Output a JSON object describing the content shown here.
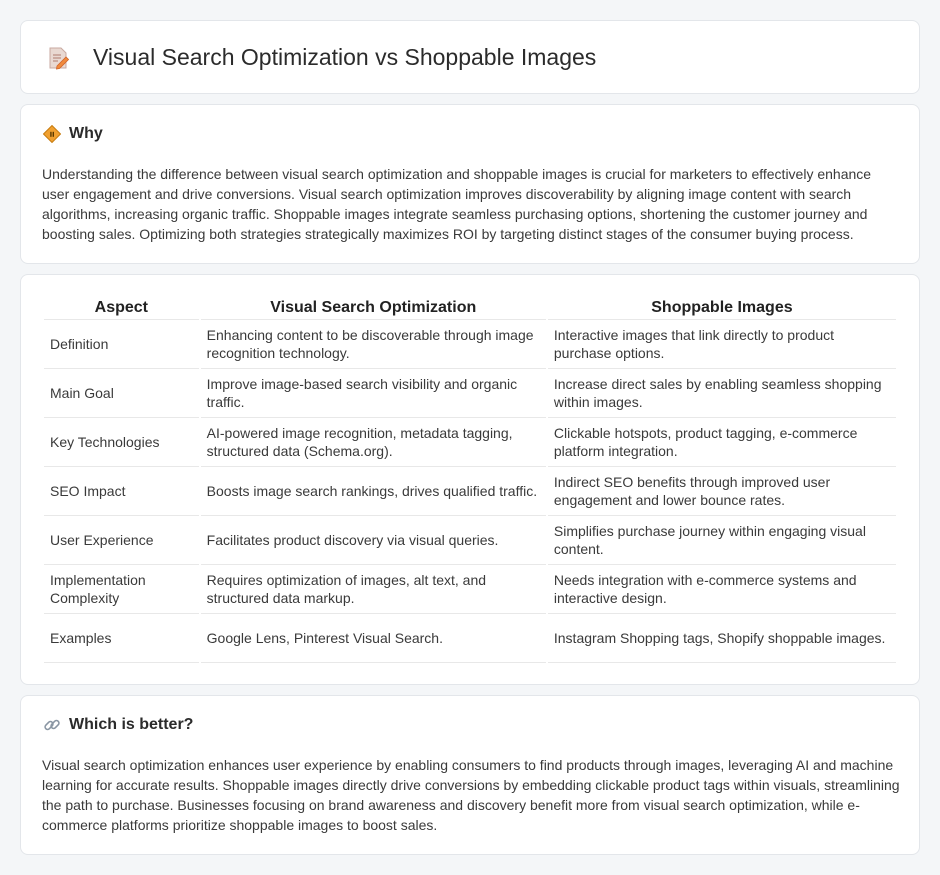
{
  "header": {
    "title": "Visual Search Optimization vs Shoppable Images",
    "icon": "document-pencil-icon"
  },
  "why": {
    "icon": "diamond-sign-icon",
    "title": "Why",
    "body": "Understanding the difference between visual search optimization and shoppable images is crucial for marketers to effectively enhance user engagement and drive conversions. Visual search optimization improves discoverability by aligning image content with search algorithms, increasing organic traffic. Shoppable images integrate seamless purchasing options, shortening the customer journey and boosting sales. Optimizing both strategies strategically maximizes ROI by targeting distinct stages of the consumer buying process."
  },
  "table": {
    "headers": [
      "Aspect",
      "Visual Search Optimization",
      "Shoppable Images"
    ],
    "rows": [
      [
        "Definition",
        "Enhancing content to be discoverable through image recognition technology.",
        "Interactive images that link directly to product purchase options."
      ],
      [
        "Main Goal",
        "Improve image-based search visibility and organic traffic.",
        "Increase direct sales by enabling seamless shopping within images."
      ],
      [
        "Key Technologies",
        "AI-powered image recognition, metadata tagging, structured data (Schema.org).",
        "Clickable hotspots, product tagging, e-commerce platform integration."
      ],
      [
        "SEO Impact",
        "Boosts image search rankings, drives qualified traffic.",
        "Indirect SEO benefits through improved user engagement and lower bounce rates."
      ],
      [
        "User Experience",
        "Facilitates product discovery via visual queries.",
        "Simplifies purchase journey within engaging visual content."
      ],
      [
        "Implementation Complexity",
        "Requires optimization of images, alt text, and structured data markup.",
        "Needs integration with e-commerce systems and interactive design."
      ],
      [
        "Examples",
        "Google Lens, Pinterest Visual Search.",
        "Instagram Shopping tags, Shopify shoppable images."
      ]
    ]
  },
  "better": {
    "icon": "link-icon",
    "title": "Which is better?",
    "body": "Visual search optimization enhances user experience by enabling consumers to find products through images, leveraging AI and machine learning for accurate results. Shoppable images directly drive conversions by embedding clickable product tags within visuals, streamlining the path to purchase. Businesses focusing on brand awareness and discovery benefit more from visual search optimization, while e-commerce platforms prioritize shoppable images to boost sales."
  },
  "colors": {
    "accent": "#f0a030",
    "card_border": "#e3e6ea",
    "background": "#f4f6f8"
  }
}
